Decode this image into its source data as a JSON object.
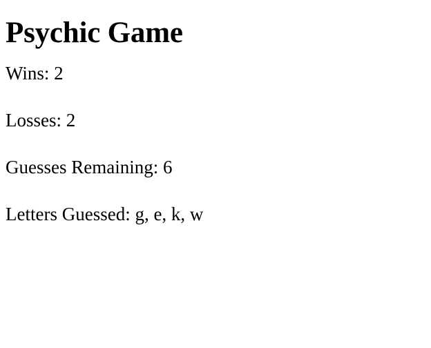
{
  "game": {
    "title": "Psychic Game",
    "wins_label": "Wins: ",
    "wins": "2",
    "losses_label": "Losses: ",
    "losses": "2",
    "remaining_label": "Guesses Remaining: ",
    "remaining": "6",
    "guessed_label": "Letters Guessed: ",
    "guessed": "g, e, k, w"
  }
}
